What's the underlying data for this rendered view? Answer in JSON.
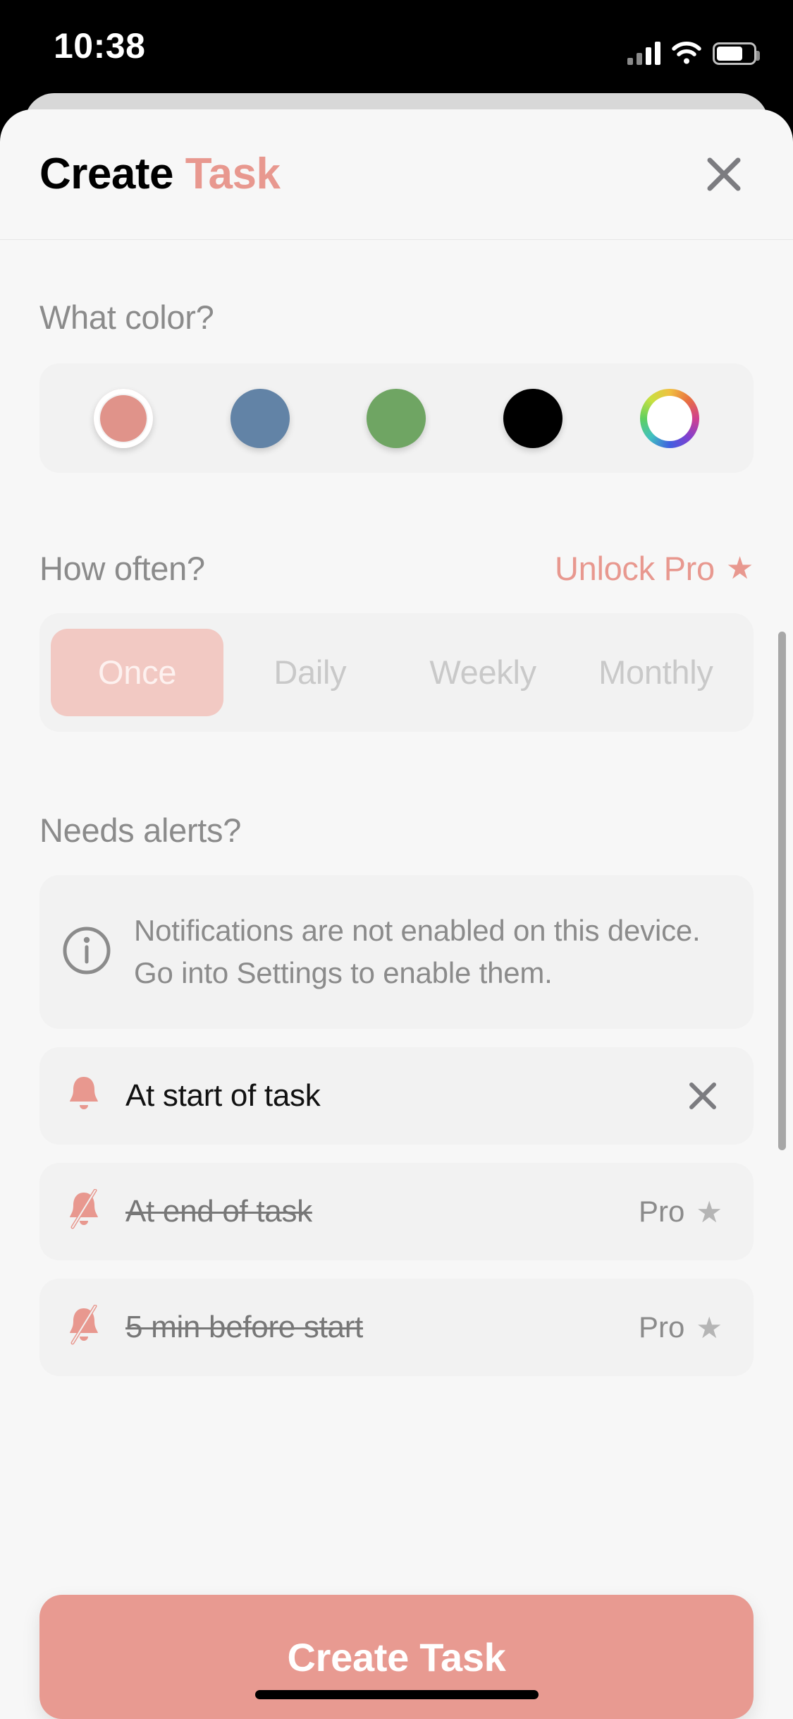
{
  "status_bar": {
    "time": "10:38",
    "signal_icon": "cellular-signal-icon",
    "wifi_icon": "wifi-icon",
    "battery_icon": "battery-icon"
  },
  "header": {
    "title_primary": "Create",
    "title_accent": "Task",
    "close_icon": "close-icon"
  },
  "color_section": {
    "label": "What color?",
    "swatches": [
      {
        "name": "salmon",
        "hex": "#e0938a",
        "selected": true,
        "type": "solid"
      },
      {
        "name": "blue",
        "hex": "#6283a6",
        "selected": false,
        "type": "solid"
      },
      {
        "name": "green",
        "hex": "#6fa563",
        "selected": false,
        "type": "solid"
      },
      {
        "name": "black",
        "hex": "#000000",
        "selected": false,
        "type": "solid"
      },
      {
        "name": "custom",
        "hex": "",
        "selected": false,
        "type": "rainbow"
      }
    ]
  },
  "frequency_section": {
    "label": "How often?",
    "unlock_pro_label": "Unlock Pro",
    "unlock_pro_star": "★",
    "options": [
      {
        "label": "Once",
        "selected": true
      },
      {
        "label": "Daily",
        "selected": false
      },
      {
        "label": "Weekly",
        "selected": false
      },
      {
        "label": "Monthly",
        "selected": false
      }
    ]
  },
  "alerts_section": {
    "label": "Needs alerts?",
    "info_icon": "info-circle-icon",
    "info_text": "Notifications are not enabled on this device. Go into Settings to enable them.",
    "rows": [
      {
        "label": "At start of task",
        "icon": "bell-icon",
        "enabled": true,
        "trailing_type": "remove",
        "trailing_label": "",
        "trailing_star": ""
      },
      {
        "label": "At end of task",
        "icon": "bell-slash-icon",
        "enabled": false,
        "trailing_type": "pro",
        "trailing_label": "Pro",
        "trailing_star": "★"
      },
      {
        "label": "5 min before start",
        "icon": "bell-slash-icon",
        "enabled": false,
        "trailing_type": "pro",
        "trailing_label": "Pro",
        "trailing_star": "★"
      }
    ]
  },
  "cta": {
    "label": "Create Task"
  },
  "colors": {
    "accent": "#e8988f",
    "accent_button": "#e89a91",
    "accent_soft": "#f2c9c3",
    "muted_text": "#8b8b8b",
    "sheet_bg": "#f7f7f7",
    "card_bg": "#f2f2f2"
  }
}
